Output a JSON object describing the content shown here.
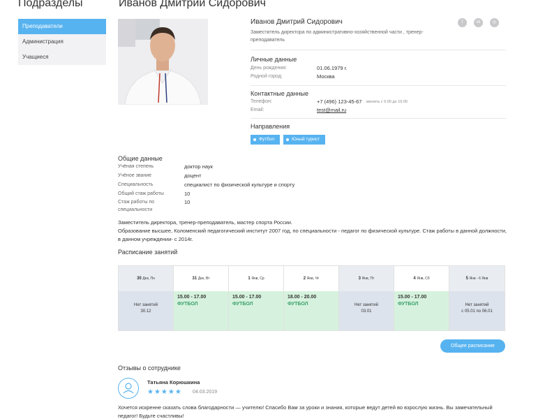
{
  "sidebar": {
    "title": "Подразделы",
    "items": [
      {
        "label": "Преподаватели"
      },
      {
        "label": "Администрация"
      },
      {
        "label": "Учащиеся"
      }
    ]
  },
  "page_title": "Иванов Дмитрий Сидорович",
  "profile": {
    "name": "Иванов Дмитрий Сидорович",
    "position": "Заместитель директора по административно-хозяйственной части , тренер-преподаватель",
    "social": [
      "facebook-icon",
      "vk-icon",
      "instagram-icon"
    ]
  },
  "personal": {
    "title": "Личные данные",
    "birthday_label": "День рождения:",
    "birthday": "01.06.1979 г.",
    "city_label": "Родной город:",
    "city": "Москва"
  },
  "contacts": {
    "title": "Контактные данные",
    "phone_label": "Телефон:",
    "phone": "+7 (496) 123-45-67",
    "phone_hint": "звонить с 9.00 до 19.00",
    "email_label": "Email:",
    "email": "test@mail.ru"
  },
  "directions": {
    "title": "Направления",
    "tags": [
      "Футбол",
      "Юный турист"
    ]
  },
  "general": {
    "title": "Общие данные",
    "rows": [
      {
        "label": "Учёная степень",
        "value": "доктор наук"
      },
      {
        "label": "Учёное звание",
        "value": "доцент"
      },
      {
        "label": "Специальность",
        "value": "специалист по физической культуре и спорту"
      },
      {
        "label": "Общий стаж работы",
        "value": "10"
      },
      {
        "label": "Стаж работы по специальности",
        "value": "10"
      }
    ],
    "bio_1": "Заместитель директора, тренер-преподаватель, мастер спорта России.",
    "bio_2": "Образование высшее, Коломенский педагогический институт 2007 год, по специальности - педагог по физической культуре. Стаж работы в данной должности, в данном учреждении- с 2014г."
  },
  "schedule": {
    "title": "Расписание занятий",
    "days": [
      {
        "num": "30",
        "month": "Дек, Пн",
        "empty": true,
        "text1": "Нет занятий",
        "text2": "30.12"
      },
      {
        "num": "31",
        "month": "Дек, Вт",
        "empty": false,
        "time": "15.00 - 17.00",
        "activity": "ФУТБОЛ"
      },
      {
        "num": "1",
        "month": "Янв, Ср",
        "empty": false,
        "time": "15.00 - 17.00",
        "activity": "ФУТБОЛ"
      },
      {
        "num": "2",
        "month": "Янв, Чт",
        "empty": false,
        "time": "18.00 - 20.00",
        "activity": "ФУТБОЛ"
      },
      {
        "num": "3",
        "month": "Янв, Пт",
        "empty": true,
        "text1": "Нет занятий",
        "text2": "03.01"
      },
      {
        "num": "4",
        "month": "Янв, Сб",
        "empty": false,
        "time": "15.00 - 17.00",
        "activity": "ФУТБОЛ"
      },
      {
        "num": "5",
        "month": "Янв - 6 Янв",
        "empty": true,
        "text1": "Нет занятий",
        "text2": "с 05.01 по 06.01"
      }
    ],
    "button": "Общее расписание"
  },
  "reviews": {
    "title": "Отзывы о сотруднике",
    "items": [
      {
        "author": "Татьяна Корюшкина",
        "rating": 5,
        "stars": "★★★★★",
        "date": "04.03.2019",
        "text": "Хочется искренне сказать слова благодарности — учителю! Спасибо Вам за уроки и знания, которые ведут детей во взрослую жизнь. Вы замечательный педагог! Будьте счастливы!"
      }
    ]
  },
  "colors": {
    "accent": "#57b3f0",
    "busy": "#d6f2de",
    "empty": "#dde3ec",
    "activity": "#3aa06a"
  }
}
